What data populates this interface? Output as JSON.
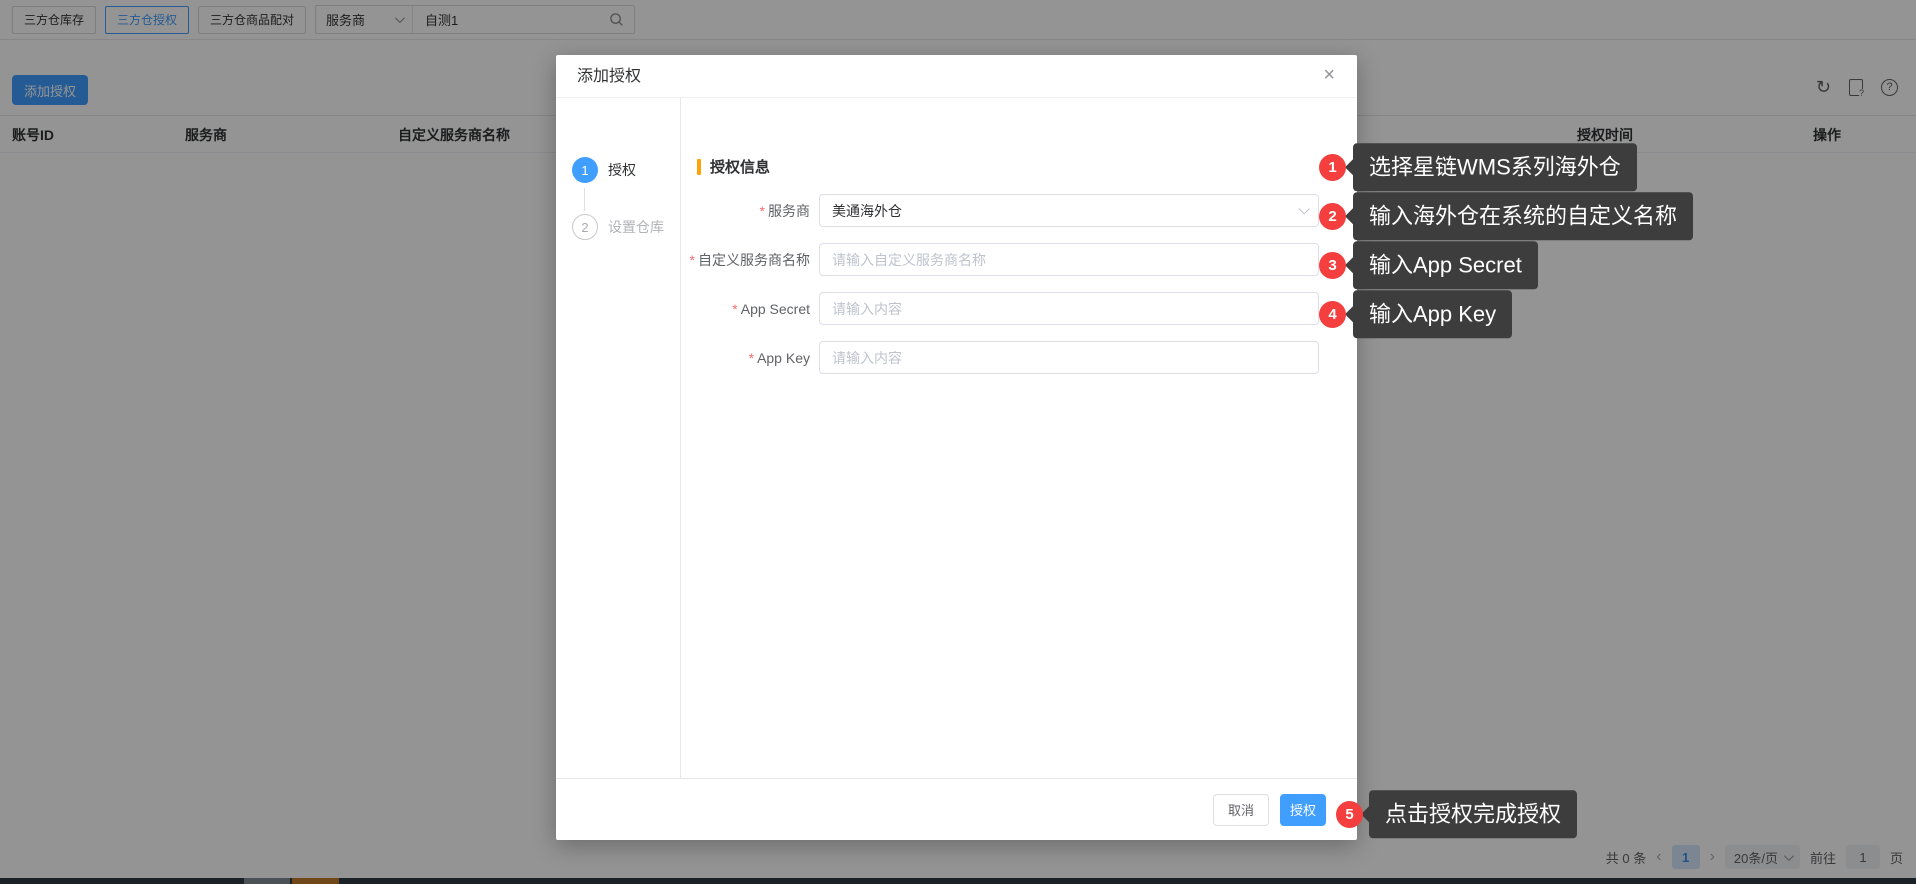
{
  "topbar": {
    "tabs": [
      {
        "label": "三方仓库存",
        "active": false
      },
      {
        "label": "三方仓授权",
        "active": true
      },
      {
        "label": "三方仓商品配对",
        "active": false
      }
    ],
    "filter_select": {
      "value": "服务商"
    },
    "search": {
      "value": "自测1"
    }
  },
  "toolbar": {
    "add_button_label": "添加授权"
  },
  "icons": {
    "refresh": "↻",
    "doc_question": "?",
    "help": "?",
    "close": "×",
    "prev": "‹",
    "next": "›"
  },
  "table": {
    "headers": [
      "账号ID",
      "服务商",
      "自定义服务商名称",
      "授权时间",
      "操作"
    ]
  },
  "pagination": {
    "total_text": "共 0 条",
    "current_page": "1",
    "size_text": "20条/页",
    "goto_label": "前往",
    "goto_value": "1",
    "unit_label": "页"
  },
  "modal": {
    "title": "添加授权",
    "required_mark": "*",
    "steps": [
      {
        "num": "1",
        "label": "授权",
        "state": "active"
      },
      {
        "num": "2",
        "label": "设置仓库",
        "state": "pending"
      }
    ],
    "section_title": "授权信息",
    "fields": [
      {
        "label": "服务商",
        "required": true,
        "type": "select",
        "value": "美通海外仓"
      },
      {
        "label": "自定义服务商名称",
        "required": true,
        "type": "input",
        "value": "",
        "placeholder": "请输入自定义服务商名称"
      },
      {
        "label": "App Secret",
        "required": true,
        "type": "input",
        "value": "",
        "placeholder": "请输入内容"
      },
      {
        "label": "App Key",
        "required": true,
        "type": "input",
        "value": "",
        "placeholder": "请输入内容"
      }
    ],
    "footer": {
      "cancel_label": "取消",
      "confirm_label": "授权"
    }
  },
  "annotations": [
    {
      "num": "1",
      "text": "选择星链WMS系列海外仓"
    },
    {
      "num": "2",
      "text": "输入海外仓在系统的自定义名称"
    },
    {
      "num": "3",
      "text": "输入App Secret"
    },
    {
      "num": "4",
      "text": "输入App Key"
    },
    {
      "num": "5",
      "text": "点击授权完成授权"
    }
  ],
  "colors": {
    "primary_blue": "#409EFF",
    "badge_red": "#F53F3F",
    "tooltip_bg": "#3D3D3D",
    "section_bar_orange": "#FFA408",
    "asterisk_red": "#F56C6C",
    "overlay": "rgba(0,0,0,0.42)"
  }
}
